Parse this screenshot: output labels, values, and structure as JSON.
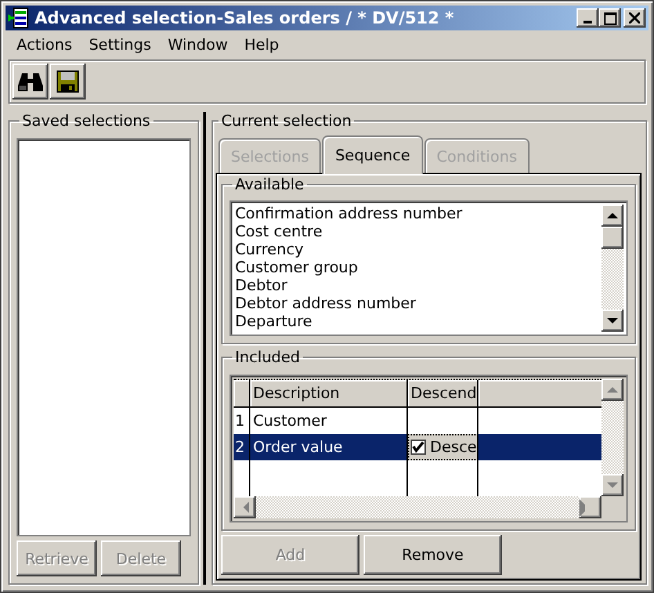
{
  "window": {
    "title": "Advanced selection-Sales orders / * DV/512 *"
  },
  "menu": [
    "Actions",
    "Settings",
    "Window",
    "Help"
  ],
  "saved_selections": {
    "title": "Saved selections",
    "buttons": [
      {
        "label": "Retrieve",
        "disabled": true
      },
      {
        "label": "Delete",
        "disabled": true
      }
    ]
  },
  "current_selection": {
    "title": "Current selection",
    "tabs": [
      {
        "label": "Selections",
        "selected": false,
        "disabled": true
      },
      {
        "label": "Sequence",
        "selected": true,
        "disabled": false
      },
      {
        "label": "Conditions",
        "selected": false,
        "disabled": true
      }
    ],
    "available": {
      "title": "Available",
      "items": [
        "Confirmation address number",
        "Cost centre",
        "Currency",
        "Customer group",
        "Debtor",
        "Debtor address number",
        "Departure"
      ]
    },
    "included": {
      "title": "Included",
      "columns": [
        "Description",
        "Descend"
      ],
      "rows": [
        {
          "number": "1",
          "description": "Customer",
          "selected": false
        },
        {
          "number": "2",
          "description": "Order value",
          "selected": true,
          "descend": {
            "checked": true,
            "label": "Desce"
          }
        }
      ]
    },
    "buttons": [
      {
        "label": "Add",
        "disabled": true
      },
      {
        "label": "Remove",
        "disabled": false
      }
    ]
  }
}
